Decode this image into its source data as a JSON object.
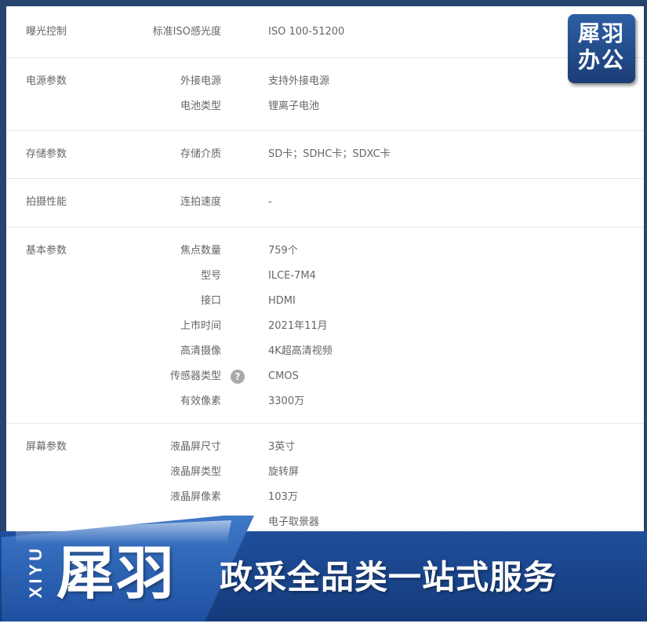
{
  "sections": [
    {
      "category": "曝光控制",
      "rows": [
        {
          "key": "标准ISO感光度",
          "value": "ISO 100-51200"
        }
      ]
    },
    {
      "category": "电源参数",
      "rows": [
        {
          "key": "外接电源",
          "value": "支持外接电源"
        },
        {
          "key": "电池类型",
          "value": "锂离子电池"
        }
      ]
    },
    {
      "category": "存储参数",
      "rows": [
        {
          "key": "存储介质",
          "value": "SD卡；SDHC卡；SDXC卡"
        }
      ]
    },
    {
      "category": "拍摄性能",
      "rows": [
        {
          "key": "连拍速度",
          "value": "-"
        }
      ]
    },
    {
      "category": "基本参数",
      "rows": [
        {
          "key": "焦点数量",
          "value": "759个"
        },
        {
          "key": "型号",
          "value": "ILCE-7M4"
        },
        {
          "key": "接口",
          "value": "HDMI"
        },
        {
          "key": "上市时间",
          "value": "2021年11月"
        },
        {
          "key": "高清摄像",
          "value": "4K超高清视频"
        },
        {
          "key": "传感器类型",
          "value": "CMOS",
          "help_icon": "?"
        },
        {
          "key": "有效像素",
          "value": "3300万"
        }
      ]
    },
    {
      "category": "屏幕参数",
      "rows": [
        {
          "key": "液晶屏尺寸",
          "value": "3英寸"
        },
        {
          "key": "液晶屏类型",
          "value": "旋转屏"
        },
        {
          "key": "液晶屏像素",
          "value": "103万"
        },
        {
          "key": "",
          "value": "电子取景器"
        }
      ]
    }
  ],
  "logo": {
    "line1": "犀羽",
    "line2": "办公"
  },
  "banner": {
    "vertical_text": "XIYU",
    "brand": "犀羽",
    "slogan": "政采全品类一站式服务"
  },
  "colors": {
    "brand_blue": "#1e4f9c",
    "label_gray": "#666666"
  }
}
